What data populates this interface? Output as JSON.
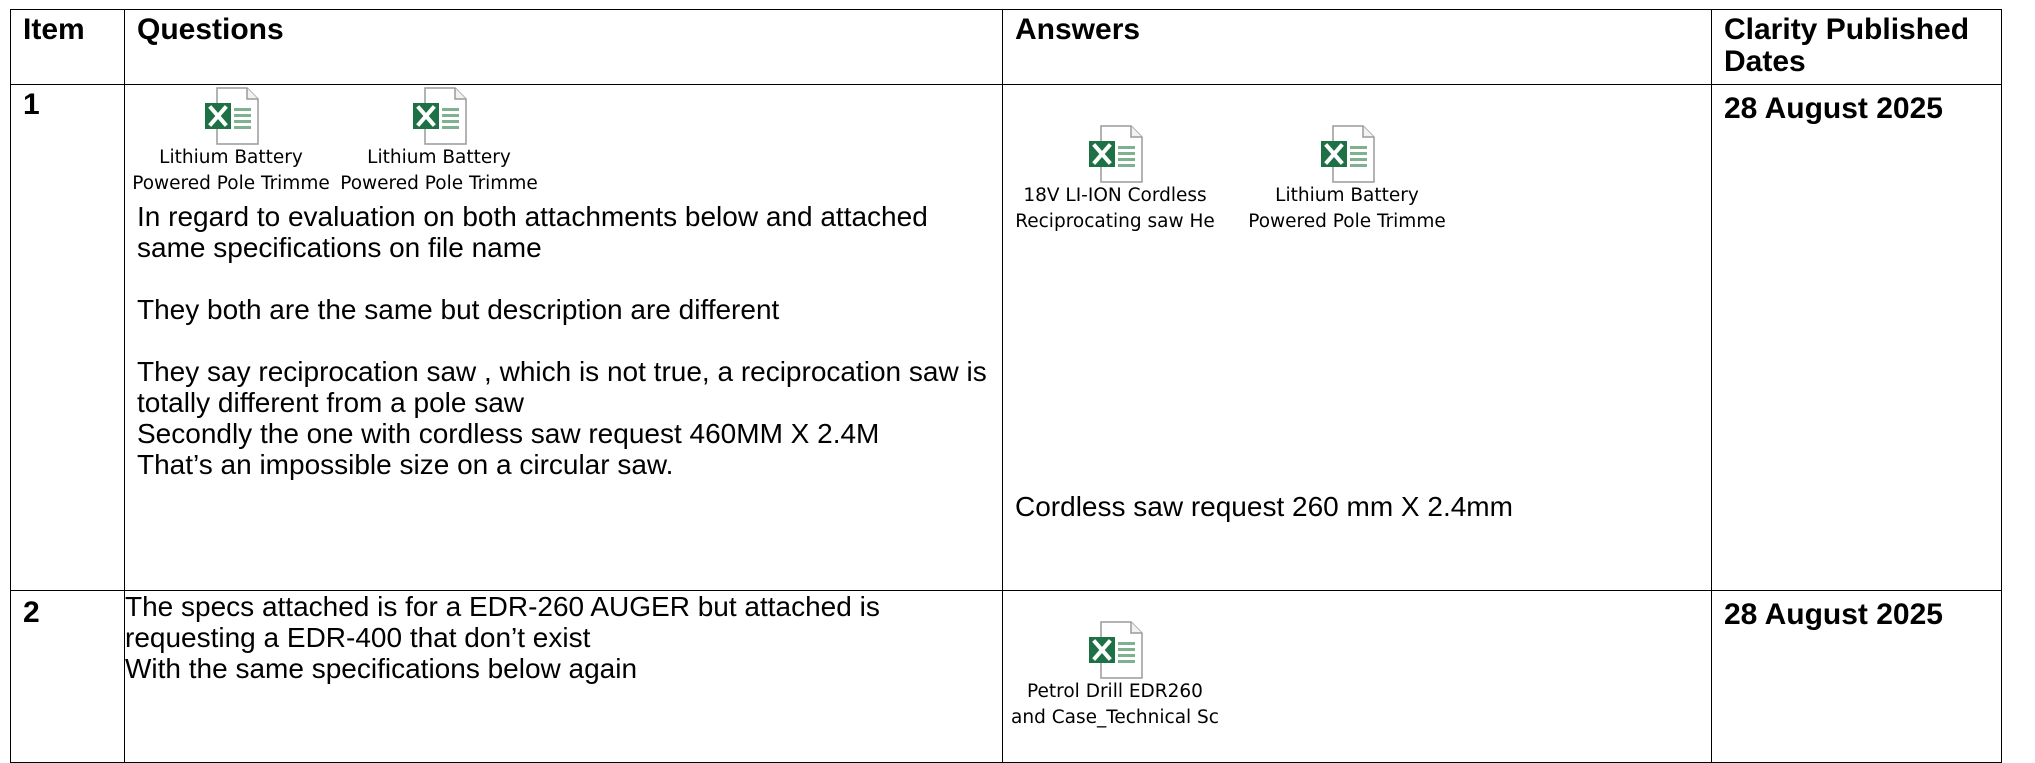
{
  "table": {
    "headers": {
      "item": "Item",
      "questions": "Questions",
      "answers": "Answers",
      "dates": "Clarity Published Dates"
    },
    "rows": [
      {
        "item": "1",
        "question_attachments": [
          {
            "label_line1": "Lithium Battery",
            "label_line2": "Powered Pole Trimme",
            "icon": "excel-file-icon"
          },
          {
            "label_line1": "Lithium Battery",
            "label_line2": "Powered Pole Trimme",
            "icon": "excel-file-icon"
          }
        ],
        "question_paragraphs": [
          "In regard to evaluation on both attachments below and attached same specifications on file name",
          "They both are the same but description are different",
          "They say reciprocation saw , which is not true, a reciprocation saw is totally different from a pole saw",
          "Secondly the one with cordless saw request 460MM X 2.4M",
          "That’s an impossible size on a circular saw."
        ],
        "answer_attachments": [
          {
            "label_line1": "18V LI-ION Cordless",
            "label_line2": "Reciprocating saw He",
            "icon": "excel-file-icon"
          },
          {
            "label_line1": "Lithium Battery",
            "label_line2": "Powered Pole Trimme",
            "icon": "excel-file-icon"
          }
        ],
        "answer_text": "Cordless saw request 260 mm X 2.4mm",
        "date": "28 August 2025"
      },
      {
        "item": "2",
        "question_paragraphs": [
          "The specs attached is for a EDR-260 AUGER but attached is requesting a EDR-400 that don’t exist",
          "With the same specifications below again"
        ],
        "answer_attachments": [
          {
            "label_line1": "Petrol  Drill EDR260",
            "label_line2": "and Case_Technical Sc",
            "icon": "excel-file-icon"
          }
        ],
        "date": "28 August 2025"
      }
    ]
  }
}
